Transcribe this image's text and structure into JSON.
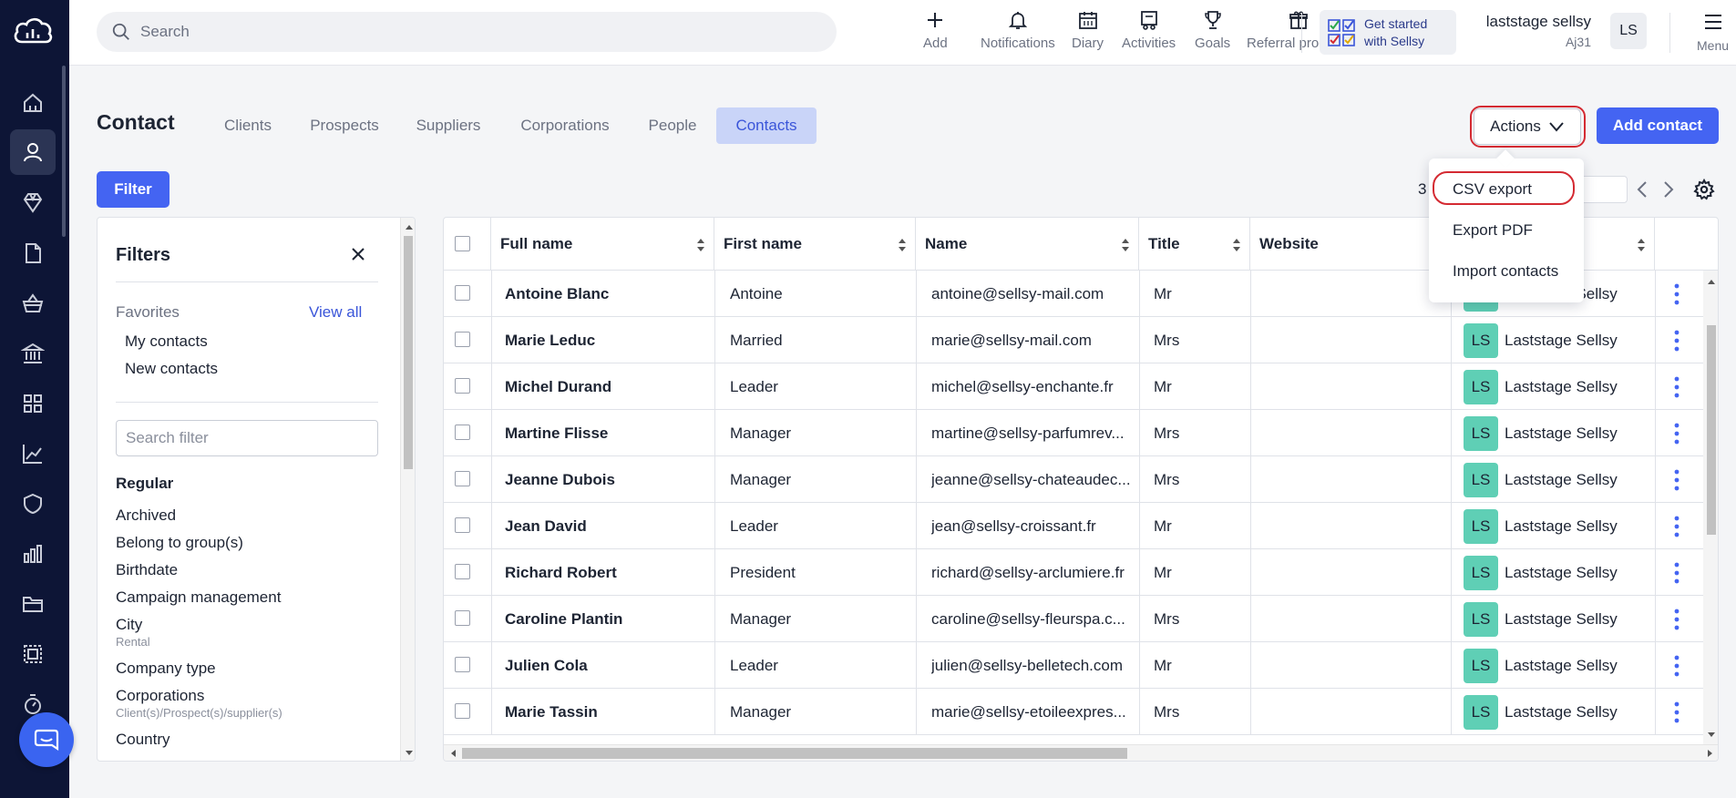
{
  "search": {
    "placeholder": "Search"
  },
  "topbar": {
    "actions": [
      {
        "label": "Add",
        "icon": "plus-icon"
      },
      {
        "label": "Notifications",
        "icon": "bell-icon"
      },
      {
        "label": "Diary",
        "icon": "calendar-icon"
      },
      {
        "label": "Activities",
        "icon": "activities-icon"
      },
      {
        "label": "Goals",
        "icon": "trophy-icon"
      },
      {
        "label": "Referral program",
        "icon": "gift-icon"
      }
    ],
    "get_started": {
      "line1": "Get started",
      "line2": "with Sellsy"
    },
    "user": {
      "name": "laststage sellsy",
      "code": "Aj31",
      "initials": "LS"
    },
    "menu_label": "Menu"
  },
  "page": {
    "title": "Contact",
    "tabs": [
      "Clients",
      "Prospects",
      "Suppliers",
      "Corporations",
      "People",
      "Contacts"
    ],
    "active_tab": "Contacts",
    "actions_label": "Actions",
    "add_contact_label": "Add contact",
    "filter_label": "Filter",
    "pagination_count": "3"
  },
  "actions_menu": {
    "items": [
      "CSV export",
      "Export PDF",
      "Import contacts"
    ]
  },
  "filters": {
    "title": "Filters",
    "favorites_label": "Favorites",
    "view_all": "View all",
    "favorites": [
      "My contacts",
      "New contacts"
    ],
    "search_placeholder": "Search filter",
    "group_title": "Regular",
    "items": [
      {
        "label": "Archived",
        "sub": ""
      },
      {
        "label": "Belong to group(s)",
        "sub": ""
      },
      {
        "label": "Birthdate",
        "sub": ""
      },
      {
        "label": "Campaign management",
        "sub": ""
      },
      {
        "label": "City",
        "sub": "Rental"
      },
      {
        "label": "Company type",
        "sub": ""
      },
      {
        "label": "Corporations",
        "sub": "Client(s)/Prospect(s)/supplier(s)"
      },
      {
        "label": "Country",
        "sub": ""
      }
    ]
  },
  "table": {
    "columns": [
      "Full name",
      "First name",
      "Name",
      "Title",
      "Website"
    ],
    "rows": [
      {
        "full_name": "Antoine Blanc",
        "first_name": "Antoine",
        "name": "antoine@sellsy-mail.com",
        "title": "Mr",
        "owner": "Laststage Sellsy",
        "owner_initials": "LS"
      },
      {
        "full_name": "Marie Leduc",
        "first_name": "Married",
        "name": "marie@sellsy-mail.com",
        "title": "Mrs",
        "owner": "Laststage Sellsy",
        "owner_initials": "LS"
      },
      {
        "full_name": "Michel Durand",
        "first_name": "Leader",
        "name": "michel@sellsy-enchante.fr",
        "title": "Mr",
        "owner": "Laststage Sellsy",
        "owner_initials": "LS"
      },
      {
        "full_name": "Martine Flisse",
        "first_name": "Manager",
        "name": "martine@sellsy-parfumrev...",
        "title": "Mrs",
        "owner": "Laststage Sellsy",
        "owner_initials": "LS"
      },
      {
        "full_name": "Jeanne Dubois",
        "first_name": "Manager",
        "name": "jeanne@sellsy-chateaudec...",
        "title": "Mrs",
        "owner": "Laststage Sellsy",
        "owner_initials": "LS"
      },
      {
        "full_name": "Jean David",
        "first_name": "Leader",
        "name": "jean@sellsy-croissant.fr",
        "title": "Mr",
        "owner": "Laststage Sellsy",
        "owner_initials": "LS"
      },
      {
        "full_name": "Richard Robert",
        "first_name": "President",
        "name": "richard@sellsy-arclumiere.fr",
        "title": "Mr",
        "owner": "Laststage Sellsy",
        "owner_initials": "LS"
      },
      {
        "full_name": "Caroline Plantin",
        "first_name": "Manager",
        "name": "caroline@sellsy-fleurspa.c...",
        "title": "Mrs",
        "owner": "Laststage Sellsy",
        "owner_initials": "LS"
      },
      {
        "full_name": "Julien Cola",
        "first_name": "Leader",
        "name": "julien@sellsy-belletech.com",
        "title": "Mr",
        "owner": "Laststage Sellsy",
        "owner_initials": "LS"
      },
      {
        "full_name": "Marie Tassin",
        "first_name": "Manager",
        "name": "marie@sellsy-etoileexpres...",
        "title": "Mrs",
        "owner": "Laststage Sellsy",
        "owner_initials": "LS"
      }
    ]
  },
  "colors": {
    "accent": "#4464f2",
    "rail": "#0d1536",
    "owner_badge": "#5fcfb5",
    "highlight_ring": "#d42a32"
  }
}
